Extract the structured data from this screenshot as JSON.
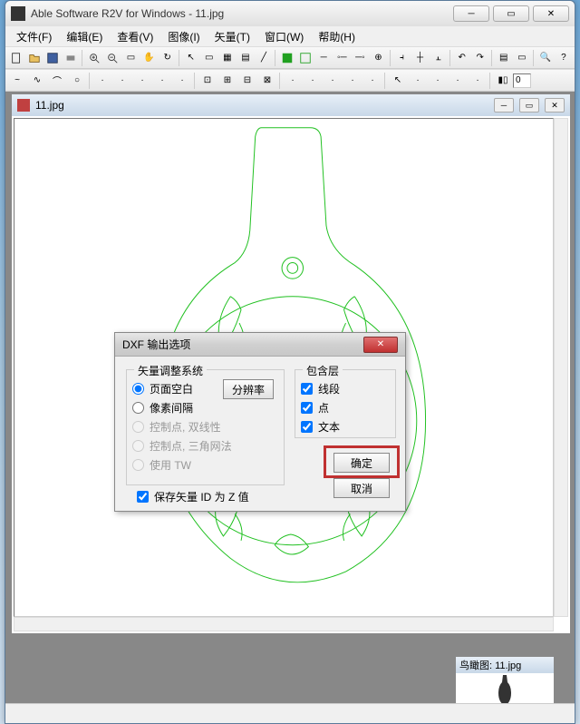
{
  "app_title": "Able Software R2V for Windows - 11.jpg",
  "menu": {
    "file": "文件(F)",
    "edit": "编辑(E)",
    "view": "查看(V)",
    "image": "图像(I)",
    "vector": "矢量(T)",
    "window": "窗口(W)",
    "help": "帮助(H)"
  },
  "toolbar": {
    "zero": "0"
  },
  "doc": {
    "title": "11.jpg"
  },
  "preview": {
    "title": "鸟瞰图: 11.jpg"
  },
  "dialog": {
    "title": "DXF 输出选项",
    "group_system": "矢量调整系统",
    "group_layers": "包含层",
    "radio_page_blank": "页面空白",
    "radio_pixel_interval": "像素间隔",
    "radio_ctrl_dbl": "控制点, 双线性",
    "radio_ctrl_tri": "控制点, 三角网法",
    "radio_use_tw": "使用 TW",
    "btn_resolution": "分辨率",
    "chk_lines": "线段",
    "chk_points": "点",
    "chk_text": "文本",
    "chk_save_id": "保存矢量 ID 为 Z 值",
    "btn_ok": "确定",
    "btn_cancel": "取消"
  }
}
